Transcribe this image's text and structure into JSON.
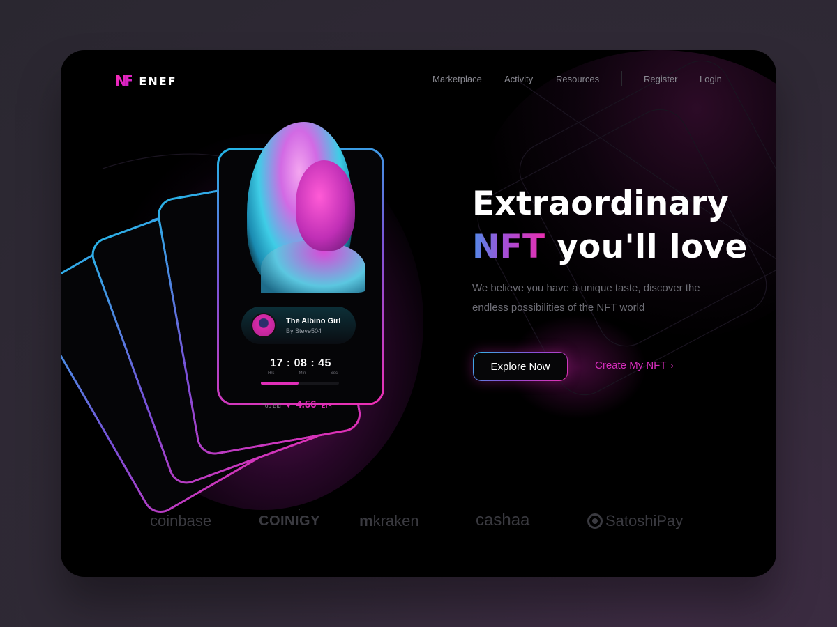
{
  "brand": {
    "name": "ENEF",
    "logo_mark": "NF",
    "accent": "#e02fb8",
    "accent_blue": "#2fb8e8"
  },
  "nav": {
    "items": [
      {
        "label": "Marketplace"
      },
      {
        "label": "Activity"
      },
      {
        "label": "Resources"
      }
    ],
    "register_label": "Register",
    "login_label": "Login"
  },
  "hero": {
    "title_line1": "Extraordinary",
    "title_highlight": "NFT",
    "title_rest": " you'll love",
    "description": "We believe you have a unique taste, discover the endless possibilities of the NFT world",
    "primary_button": "Explore Now",
    "secondary_button": "Create My NFT",
    "secondary_icon": "chevron-right-icon"
  },
  "nft_card": {
    "name": "The Albino Girl",
    "creator": "By Steve504",
    "timer": {
      "hours": "17",
      "minutes": "08",
      "seconds": "45",
      "separator": ":"
    },
    "timer_labels": {
      "hours": "Hrs",
      "minutes": "Min",
      "seconds": "Sec"
    },
    "progress_percent": 48,
    "top_bid_label": "Top Bid",
    "eth_symbol": "♦",
    "bid_value": "4.56",
    "bid_unit": "ETH"
  },
  "partners": [
    {
      "name": "coinbase"
    },
    {
      "name": "COINIGY"
    },
    {
      "name": "kraken",
      "icon": "ⴷ"
    },
    {
      "name": "cashaa"
    },
    {
      "name": "SatoshiPay"
    }
  ]
}
